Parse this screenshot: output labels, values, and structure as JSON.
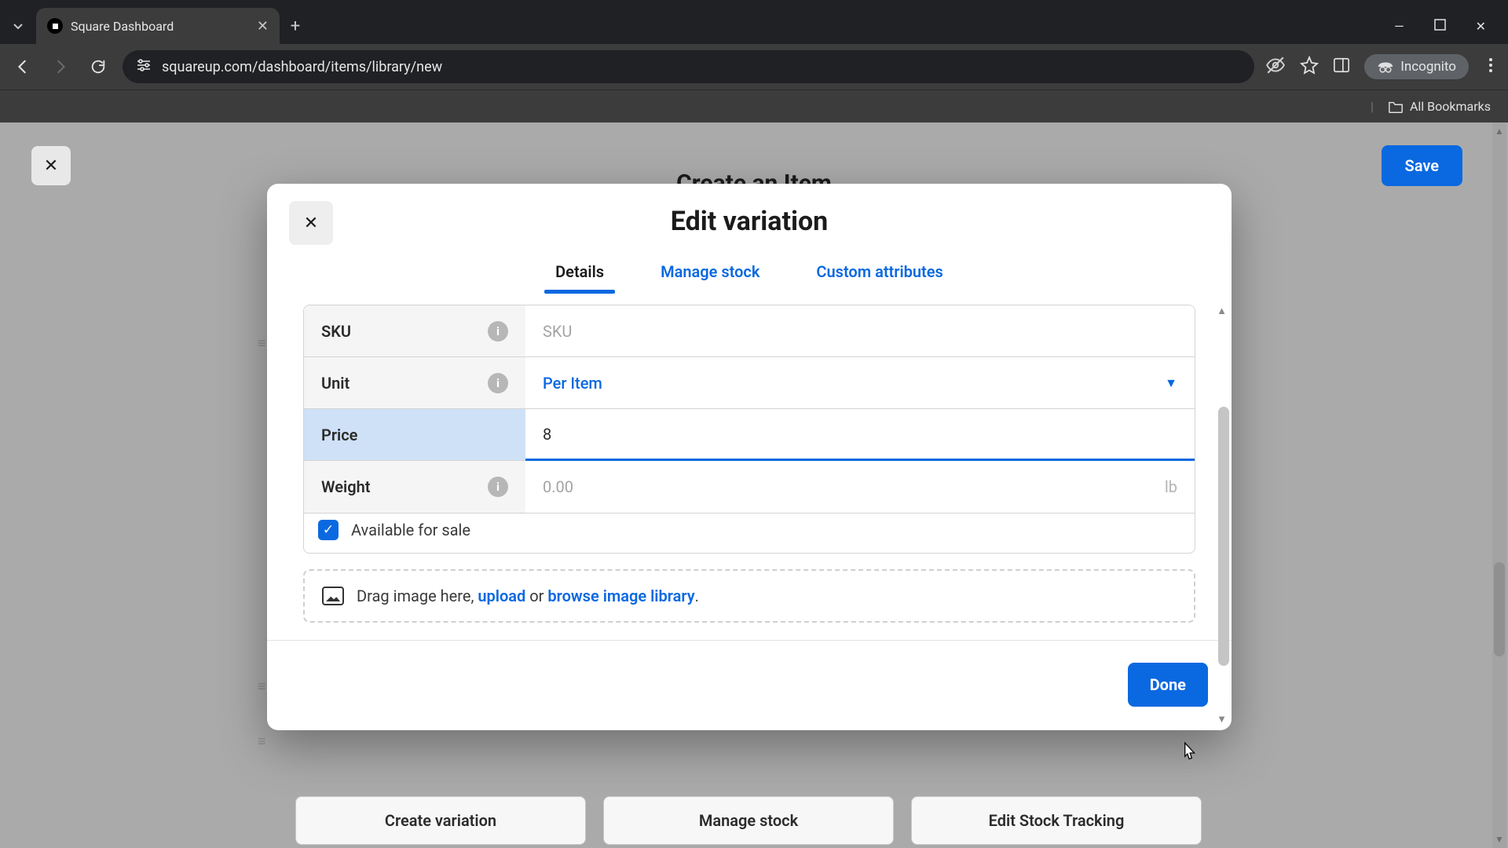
{
  "browser": {
    "tab_title": "Square Dashboard",
    "url": "squareup.com/dashboard/items/library/new",
    "incognito_label": "Incognito",
    "all_bookmarks": "All Bookmarks"
  },
  "page": {
    "title_behind": "Create an Item",
    "save_label": "Save",
    "close_icon": "✕",
    "bg_actions": {
      "create_variation": "Create variation",
      "manage_stock": "Manage stock",
      "edit_stock_tracking": "Edit Stock Tracking"
    }
  },
  "modal": {
    "title": "Edit variation",
    "tabs": {
      "details": "Details",
      "manage_stock": "Manage stock",
      "custom_attributes": "Custom attributes"
    },
    "fields": {
      "sku_label": "SKU",
      "sku_placeholder": "SKU",
      "unit_label": "Unit",
      "unit_value": "Per Item",
      "price_label": "Price",
      "price_value": "8",
      "weight_label": "Weight",
      "weight_placeholder": "0.00",
      "weight_unit": "lb"
    },
    "available_label": "Available for sale",
    "drop": {
      "pre": "Drag image here, ",
      "upload": "upload",
      "or": " or ",
      "browse": "browse image library",
      "dot": "."
    },
    "done_label": "Done"
  }
}
